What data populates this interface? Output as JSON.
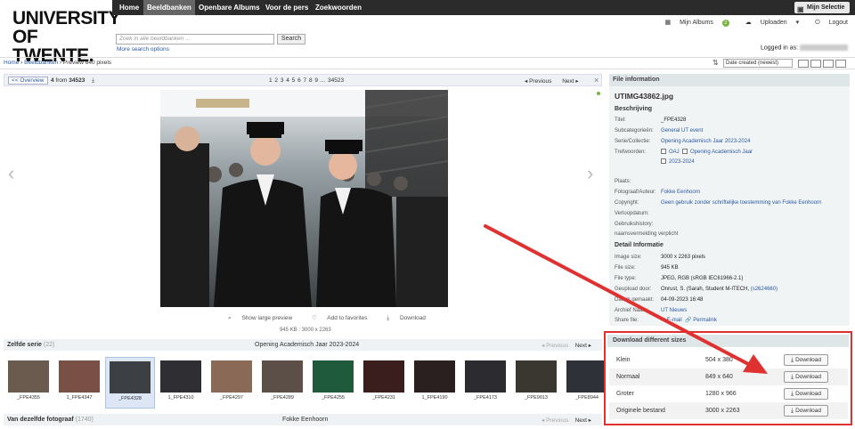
{
  "logo": {
    "line1": "UNIVERSITY",
    "line2": "OF TWENTE."
  },
  "nav": [
    "Home",
    "Beeldbanken",
    "Openbare Albums",
    "Voor de pers",
    "Zoekwoorden"
  ],
  "selectie": "Mijn Selectie",
  "search": {
    "placeholder": "Zoek in alle beeldbanken ...",
    "button": "Search",
    "more": "More search options"
  },
  "topright": {
    "albums": "Mijn Albums",
    "albums_count": "2",
    "upload": "Uploaden",
    "logout": "Logout"
  },
  "logged_in_label": "Logged in as:",
  "breadcrumb": [
    "Home",
    "Beeldbanken",
    "Preview 640 pixels"
  ],
  "sort": {
    "selected": "Date created (newest)"
  },
  "toolbar": {
    "overview": "<< Overview",
    "counter_a": "4",
    "counter_mid": " from ",
    "counter_b": "34523",
    "pages": "1 2 3 4 5 6 7 8 9 ... 34523",
    "prev": "Previous",
    "next": "Next",
    "close": "×"
  },
  "photo_actions": {
    "large": "Show large preview",
    "fav": "Add to favorites",
    "download": "Download"
  },
  "photo_size": "945 KB : 3000 x 2263",
  "serie": {
    "title": "Zelfde serie",
    "count": "(22)",
    "center": "Opening Academisch Jaar 2023-2024",
    "prev": "Previous",
    "next": "Next"
  },
  "thumbs": [
    "_FPE4355",
    "1_FPE4347",
    "_FPE4328",
    "1_FPE4310",
    "_FPE4297",
    "_FPE4289",
    "_FPE4255",
    "_FPE4231",
    "1_FPE4190",
    "_FPE4173",
    "_FPE9013",
    "_FPE8944"
  ],
  "foto": {
    "title": "Van dezelfde fotograaf",
    "count": "(1740)",
    "center": "Fokke Eenhoorn",
    "prev": "Previous",
    "next": "Next"
  },
  "info": {
    "header": "File information",
    "filename": "UTIMG43862.jpg",
    "beschrijving": "Beschrijving",
    "titel_k": "Titel:",
    "titel_v": "_FPE4328",
    "subcat_k": "Subcategorieën:",
    "subcat_v": "General UT event",
    "serie_k": "Serie/Collectie:",
    "serie_v": "Opening Academisch Jaar 2023-2024",
    "trefw_k": "Trefwoorden:",
    "trefw_1": "OAJ",
    "trefw_2": "Opening Academisch Jaar",
    "trefw_3": "2023-2024",
    "plaats_k": "Plaats:",
    "fotograaf_k": "Fotograaf/Auteur:",
    "fotograaf_v": "Fokke Eenhoorn",
    "copyright_k": "Copyright:",
    "copyright_v": "Geen gebruik zonder schriftelijke toestemming van Fokke Eenhoorn",
    "verloop_k": "Verloopdatum:",
    "gebruik_k": "Gebruikshistory:",
    "naams": "naamsvermelding verplicht",
    "detail": "Detail Informatie",
    "imgsize_k": "Image size:",
    "imgsize_v": "3000 x 2263 pixels",
    "filesize_k": "File size:",
    "filesize_v": "945 KB",
    "filetype_k": "File type:",
    "filetype_v": "JPEG, RGB (sRGB IEC61966-2.1)",
    "geup_k": "Geupload door:",
    "geup_v": "Onrust, S. (Sarah, Student M-ITECH,",
    "geup_v2": "(s2624660)",
    "datum_k": "Datum gemaakt:",
    "datum_v": "04-09-2023 16:48",
    "archief_k": "Archief Naam:",
    "archief_v": "UT Nieuws",
    "share_k": "Share file:",
    "share_mail": "E-mail",
    "share_perma": "Permalink"
  },
  "downloads": {
    "header": "Download different sizes",
    "rows": [
      {
        "name": "Klein",
        "size": "504 x 380",
        "btn": "Download"
      },
      {
        "name": "Normaal",
        "size": "849 x 640",
        "btn": "Download"
      },
      {
        "name": "Groter",
        "size": "1280 x 966",
        "btn": "Download"
      },
      {
        "name": "Originele bestand",
        "size": "3000 x 2263",
        "btn": "Download"
      }
    ]
  },
  "colors": {
    "nav_bg": "#2b2b2b",
    "accent_link": "#2a5aa0",
    "highlight_red": "#e03131",
    "panel_bg": "#f1f4f5"
  }
}
